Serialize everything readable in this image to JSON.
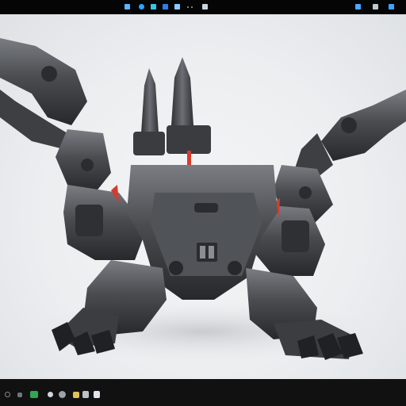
{
  "window": {
    "top_icons": [
      "app-icon",
      "edge-icon",
      "store-icon",
      "mail-icon",
      "explorer-icon",
      "settings-icon"
    ],
    "tray_icons": [
      "network-icon",
      "volume-icon",
      "battery-icon"
    ]
  },
  "viewport": {
    "subject": "robot-scorpion-model",
    "background": "#eceef0",
    "body_color": "#4a4c50",
    "accent_color": "#d63b2e"
  },
  "taskbar": {
    "items": [
      "start-icon",
      "search-icon",
      "terminal-icon",
      "chat-icon",
      "browser-icon",
      "folder-icon",
      "media-icon"
    ]
  }
}
